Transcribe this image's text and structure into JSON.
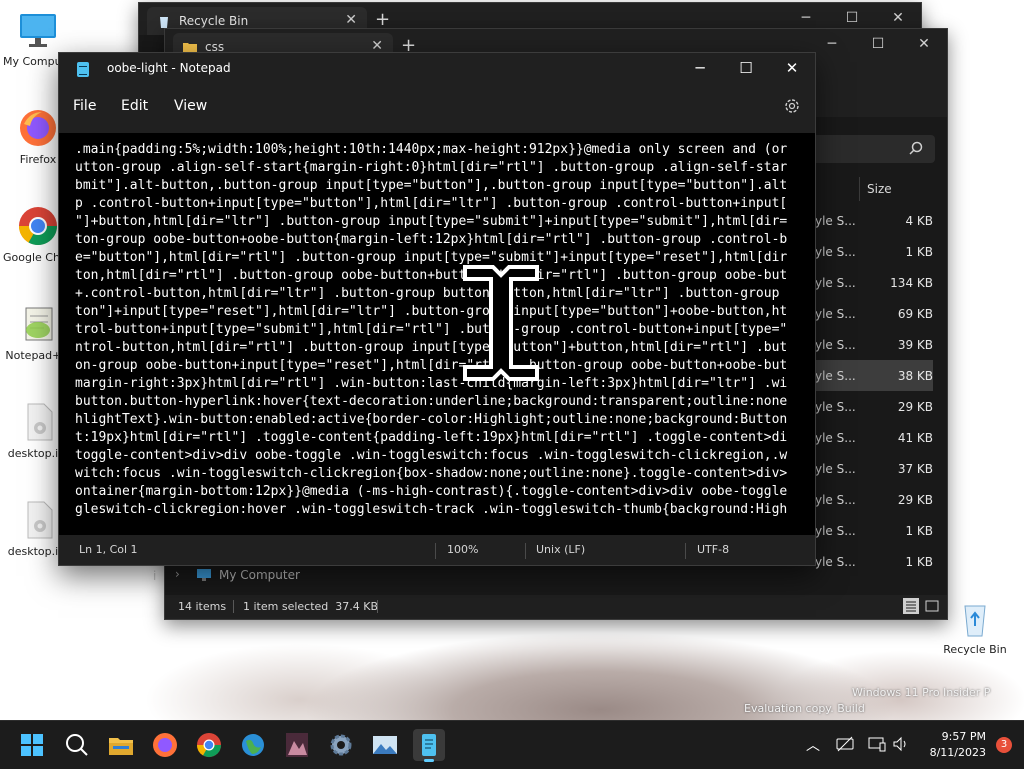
{
  "desktop": {
    "icons": [
      {
        "label": "My Computer"
      },
      {
        "label": "Firefox"
      },
      {
        "label": "Google Chrome"
      },
      {
        "label": "Notepad++"
      },
      {
        "label": "desktop.ini"
      },
      {
        "label": "desktop.ini"
      }
    ],
    "recycle_label": "Recycle Bin",
    "watermark_line1": "Windows 11 Pro Insider P",
    "watermark_line2": "Evaluation copy. Build"
  },
  "explorer_back": {
    "tab_title": "Recycle Bin",
    "tab_close": "✕",
    "new_tab": "+",
    "controls": {
      "minimize": "─",
      "maximize": "☐",
      "close": "✕"
    }
  },
  "explorer_front": {
    "tab_title": "css",
    "tab_close": "✕",
    "new_tab": "+",
    "controls": {
      "minimize": "─",
      "maximize": "☐",
      "close": "✕"
    },
    "column_size": "Size",
    "rows": [
      {
        "type": "yle S...",
        "size": "4 KB",
        "selected": false
      },
      {
        "type": "yle S...",
        "size": "1 KB",
        "selected": false
      },
      {
        "type": "yle S...",
        "size": "134 KB",
        "selected": false
      },
      {
        "type": "yle S...",
        "size": "69 KB",
        "selected": false
      },
      {
        "type": "yle S...",
        "size": "39 KB",
        "selected": false
      },
      {
        "type": "yle S...",
        "size": "38 KB",
        "selected": true
      },
      {
        "type": "yle S...",
        "size": "29 KB",
        "selected": false
      },
      {
        "type": "yle S...",
        "size": "41 KB",
        "selected": false
      },
      {
        "type": "yle S...",
        "size": "37 KB",
        "selected": false
      },
      {
        "type": "yle S...",
        "size": "29 KB",
        "selected": false
      },
      {
        "type": "yle S...",
        "size": "1 KB",
        "selected": false
      },
      {
        "type": "yle S...",
        "size": "1 KB",
        "selected": false
      }
    ],
    "nav_item": "My Computer",
    "nav_partial": "i",
    "status_items": "14 items",
    "status_selected": "1 item selected  37.4 KB"
  },
  "notepad": {
    "title": "oobe-light - Notepad",
    "controls": {
      "minimize": "─",
      "maximize": "☐",
      "close": "✕"
    },
    "menu": {
      "file": "File",
      "edit": "Edit",
      "view": "View"
    },
    "content": ".main{padding:5%;width:100%;height:10th:1440px;max-height:912px}}@media only screen and (or\nutton-group .align-self-start{margin-right:0}html[dir=\"rtl\"] .button-group .align-self-star\nbmit\"].alt-button,.button-group input[type=\"button\"],.button-group input[type=\"button\"].alt\np .control-button+input[type=\"button\"],html[dir=\"ltr\"] .button-group .control-button+input[\n\"]+button,html[dir=\"ltr\"] .button-group input[type=\"submit\"]+input[type=\"submit\"],html[dir=\nton-group oobe-button+oobe-button{margin-left:12px}html[dir=\"rtl\"] .button-group .control-b\ne=\"button\"],html[dir=\"rtl\"] .button-group input[type=\"submit\"]+input[type=\"reset\"],html[dir\nton,html[dir=\"rtl\"] .button-group oobe-button+button,html[dir=\"rtl\"] .button-group oobe-but\n+.control-button,html[dir=\"ltr\"] .button-group button+button,html[dir=\"ltr\"] .button-group \nton\"]+input[type=\"reset\"],html[dir=\"ltr\"] .button-group input[type=\"button\"]+oobe-button,ht\ntrol-button+input[type=\"submit\"],html[dir=\"rtl\"] .button-group .control-button+input[type=\"\nntrol-button,html[dir=\"rtl\"] .button-group input[type=\"button\"]+button,html[dir=\"rtl\"] .but\non-group oobe-button+input[type=\"reset\"],html[dir=\"rtl\"] .button-group oobe-button+oobe-but\nmargin-right:3px}html[dir=\"rtl\"] .win-button:last-child{margin-left:3px}html[dir=\"ltr\"] .wi\nbutton.button-hyperlink:hover{text-decoration:underline;background:transparent;outline:none\nhlightText}.win-button:enabled:active{border-color:Highlight;outline:none;background:Button\nt:19px}html[dir=\"rtl\"] .toggle-content{padding-left:19px}html[dir=\"rtl\"] .toggle-content>di\ntoggle-content>div>div oobe-toggle .win-toggleswitch:focus .win-toggleswitch-clickregion,.w\nwitch:focus .win-toggleswitch-clickregion{box-shadow:none;outline:none}.toggle-content>div>\nontainer{margin-bottom:12px}}@media (-ms-high-contrast){.toggle-content>div>div oobe-toggle\ngleswitch-clickregion:hover .win-toggleswitch-track .win-toggleswitch-thumb{background:High",
    "status": {
      "position": "Ln 1, Col 1",
      "zoom": "100%",
      "line_ending": "Unix (LF)",
      "encoding": "UTF-8"
    }
  },
  "taskbar": {
    "apps": [
      "start-icon",
      "search-icon",
      "file-explorer-icon",
      "firefox-icon",
      "chrome-icon",
      "globe-icon",
      "photo-icon",
      "settings-icon",
      "image-viewer-icon",
      "notepad-icon"
    ],
    "active_app": "notepad-icon",
    "time": "9:57 PM",
    "date": "8/11/2023",
    "notification_count": "3",
    "tray_chevron": "︿"
  },
  "colors": {
    "accent": "#60cdff",
    "selection": "#3d3d3d",
    "notification": "#e8503a"
  }
}
